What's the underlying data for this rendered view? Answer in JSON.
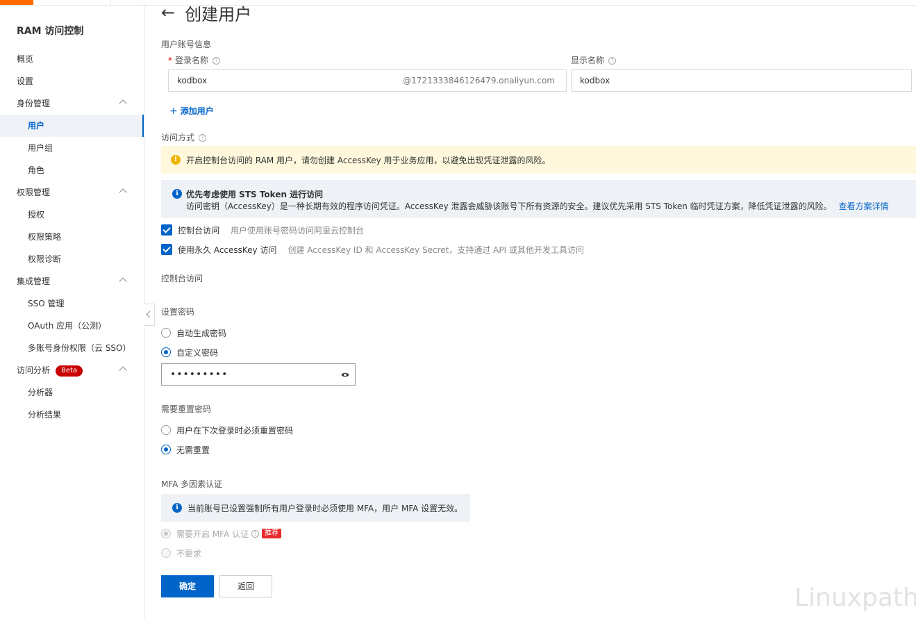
{
  "sidebar": {
    "title": "RAM 访问控制",
    "items": [
      {
        "label": "概览",
        "level": 0
      },
      {
        "label": "设置",
        "level": 0
      },
      {
        "label": "身份管理",
        "level": 0,
        "expandable": true
      },
      {
        "label": "用户",
        "level": 1,
        "active": true
      },
      {
        "label": "用户组",
        "level": 1
      },
      {
        "label": "角色",
        "level": 1
      },
      {
        "label": "权限管理",
        "level": 0,
        "expandable": true
      },
      {
        "label": "授权",
        "level": 1
      },
      {
        "label": "权限策略",
        "level": 1
      },
      {
        "label": "权限诊断",
        "level": 1
      },
      {
        "label": "集成管理",
        "level": 0,
        "expandable": true
      },
      {
        "label": "SSO 管理",
        "level": 1
      },
      {
        "label": "OAuth 应用（公测）",
        "level": 1
      },
      {
        "label": "多账号身份权限（云 SSO）",
        "level": 1
      },
      {
        "label": "访问分析",
        "level": 0,
        "expandable": true,
        "badge": "Beta"
      },
      {
        "label": "分析器",
        "level": 1
      },
      {
        "label": "分析结果",
        "level": 1
      }
    ]
  },
  "page": {
    "title": "创建用户",
    "account_section": "用户账号信息",
    "login_name_label": "登录名称",
    "login_name_value": "kodbox",
    "login_name_suffix": "@1721333846126479.onaliyun.com",
    "display_name_label": "显示名称",
    "display_name_value": "kodbox",
    "add_user": "添加用户",
    "access_mode_label": "访问方式",
    "warning_text": "开启控制台访问的 RAM 用户，请勿创建 AccessKey 用于业务应用，以避免出现凭证泄露的风险。",
    "info_title": "优先考虑使用 STS Token 进行访问",
    "info_text": "访问密钥（AccessKey）是一种长期有效的程序访问凭证。AccessKey 泄露会威胁该账号下所有资源的安全。建议优先采用 STS Token 临时凭证方案，降低凭证泄露的风险。",
    "info_link": "查看方案详情",
    "cb_console_label": "控制台访问",
    "cb_console_desc": "用户使用账号密码访问阿里云控制台",
    "cb_ak_label": "使用永久 AccessKey 访问",
    "cb_ak_desc": "创建 AccessKey ID 和 AccessKey Secret，支持通过 API 或其他开发工具访问",
    "console_section": "控制台访问",
    "set_password_label": "设置密码",
    "radio_auto": "自动生成密码",
    "radio_custom": "自定义密码",
    "password_masked": "•••••••••",
    "reset_label": "需要重置密码",
    "radio_reset_next": "用户在下次登录时必须重置密码",
    "radio_no_reset": "无需重置",
    "mfa_label": "MFA 多因素认证",
    "mfa_info": "当前账号已设置强制所有用户登录时必须使用 MFA，用户 MFA 设置无效。",
    "radio_mfa_required": "需要开启 MFA 认证",
    "mfa_tag": "推荐",
    "radio_mfa_no": "不要求",
    "confirm": "确定",
    "back": "返回"
  },
  "watermark": "Linuxpath",
  "colors": {
    "primary": "#0064c8",
    "warning_bg": "#fff8dd",
    "info_bg": "#eef1f6",
    "brand": "#ff6a00"
  }
}
